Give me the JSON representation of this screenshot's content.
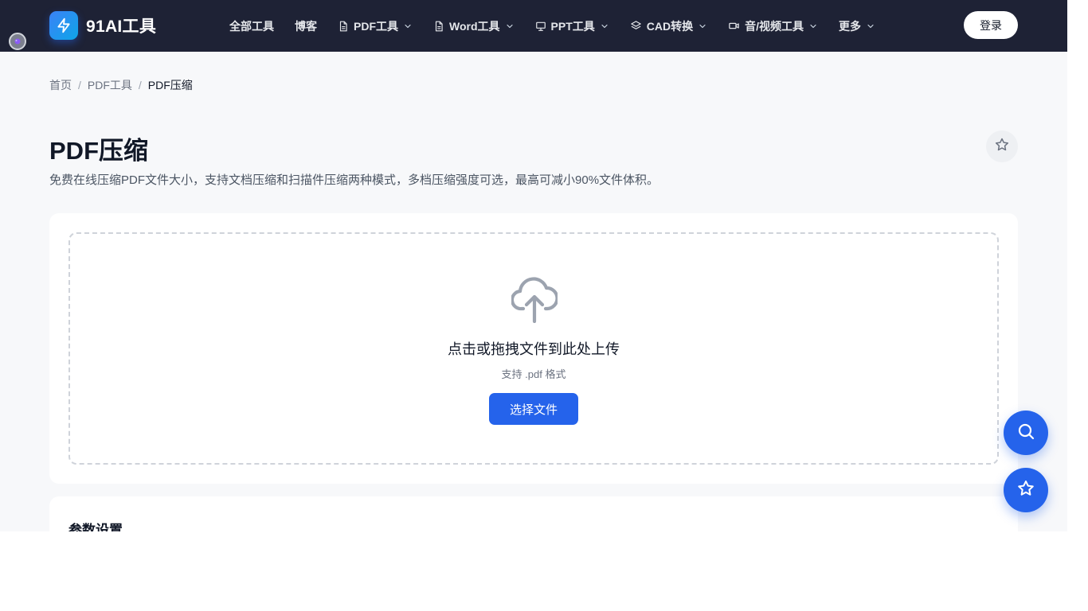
{
  "header": {
    "logo_text": "91AI工具",
    "nav": [
      {
        "label": "全部工具",
        "icon": "",
        "dropdown": false
      },
      {
        "label": "博客",
        "icon": "",
        "dropdown": false
      },
      {
        "label": "PDF工具",
        "icon": "document-icon",
        "dropdown": true
      },
      {
        "label": "Word工具",
        "icon": "document-icon",
        "dropdown": true
      },
      {
        "label": "PPT工具",
        "icon": "presentation-icon",
        "dropdown": true
      },
      {
        "label": "CAD转换",
        "icon": "layers-icon",
        "dropdown": true
      },
      {
        "label": "音/视频工具",
        "icon": "video-icon",
        "dropdown": true
      },
      {
        "label": "更多",
        "icon": "",
        "dropdown": true
      }
    ],
    "login_label": "登录"
  },
  "breadcrumb": {
    "items": [
      "首页",
      "PDF工具"
    ],
    "separator": "/",
    "current": "PDF压缩"
  },
  "page": {
    "title": "PDF压缩",
    "description": "免费在线压缩PDF文件大小，支持文档压缩和扫描件压缩两种模式，多档压缩强度可选，最高可减小90%文件体积。"
  },
  "upload": {
    "title": "点击或拖拽文件到此处上传",
    "hint": "支持 .pdf 格式",
    "button_label": "选择文件"
  },
  "params": {
    "title": "参数设置"
  },
  "colors": {
    "header_bg": "#1e2235",
    "accent": "#2563eb",
    "page_bg": "#f7f8fa"
  }
}
